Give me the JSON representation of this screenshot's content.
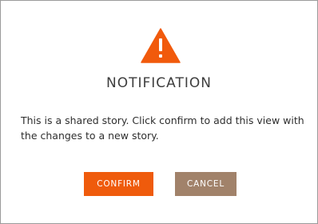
{
  "dialog": {
    "icon": "warning-triangle-icon",
    "title": "NOTIFICATION",
    "message": "This is a shared story. Click confirm to add this view with the changes to a new story.",
    "buttons": {
      "confirm_label": "CONFIRM",
      "cancel_label": "CANCEL"
    }
  },
  "colors": {
    "icon": "#f15a0c",
    "confirm_button": "#ef5b0c",
    "cancel_button": "#a1826a",
    "title_text": "#3d3d3d"
  }
}
